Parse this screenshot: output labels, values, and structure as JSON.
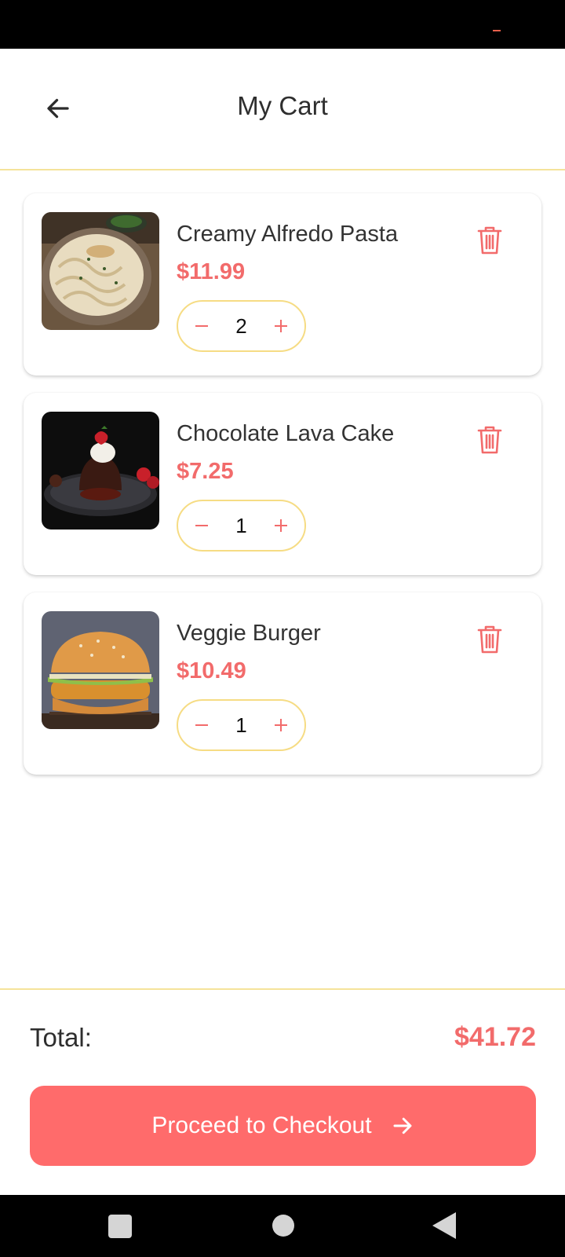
{
  "header": {
    "title": "My Cart",
    "back_icon": "arrow-left-icon"
  },
  "cart": {
    "items": [
      {
        "name": "Creamy Alfredo Pasta",
        "price": "$11.99",
        "quantity": "2",
        "image": "pasta-photo"
      },
      {
        "name": "Chocolate Lava Cake",
        "price": "$7.25",
        "quantity": "1",
        "image": "lava-cake-photo"
      },
      {
        "name": "Veggie Burger",
        "price": "$10.49",
        "quantity": "1",
        "image": "burger-photo"
      }
    ],
    "minus_icon": "minus-icon",
    "plus_icon": "plus-icon",
    "delete_icon": "trash-icon"
  },
  "summary": {
    "total_label": "Total:",
    "total_value": "$41.72"
  },
  "checkout": {
    "label": "Proceed to Checkout",
    "icon": "arrow-right-icon"
  },
  "colors": {
    "accent": "#ff6b6b",
    "price": "#f26b6b",
    "border": "#f6dc84",
    "divider": "#f5e39a"
  },
  "system_nav": {
    "recent_icon": "square-icon",
    "home_icon": "circle-icon",
    "back_icon": "triangle-back-icon"
  }
}
